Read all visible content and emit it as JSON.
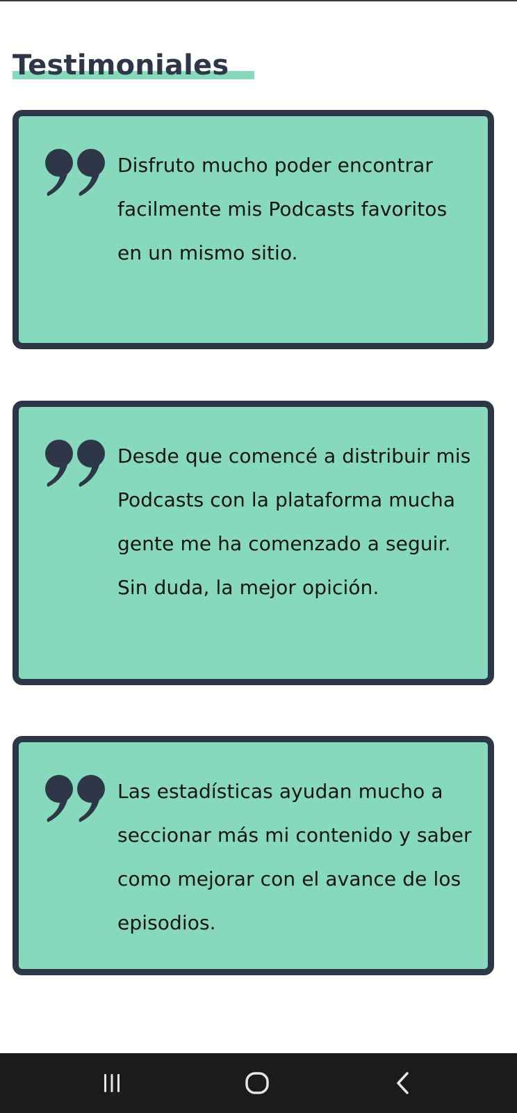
{
  "section": {
    "title": "Testimoniales"
  },
  "testimonials": [
    {
      "icon": "quote-icon",
      "text": "Disfruto mucho poder encontrar facilmente mis Podcasts favoritos en un mismo sitio."
    },
    {
      "icon": "quote-icon",
      "text": "Desde que comencé a distribuir mis Podcasts con la plataforma mucha gente me ha comenzado a seguir. Sin duda, la mejor opición."
    },
    {
      "icon": "quote-icon",
      "text": "Las estadísticas ayudan mucho a seccionar más mi contenido y saber como mejorar con el avance de los episodios."
    }
  ],
  "navigation_bar": {
    "icons": [
      "recent-apps-icon",
      "home-icon",
      "back-icon"
    ]
  },
  "colors": {
    "accent": "#86d9bc",
    "dark": "#2d3748",
    "nav_background": "#1b1a1d"
  }
}
